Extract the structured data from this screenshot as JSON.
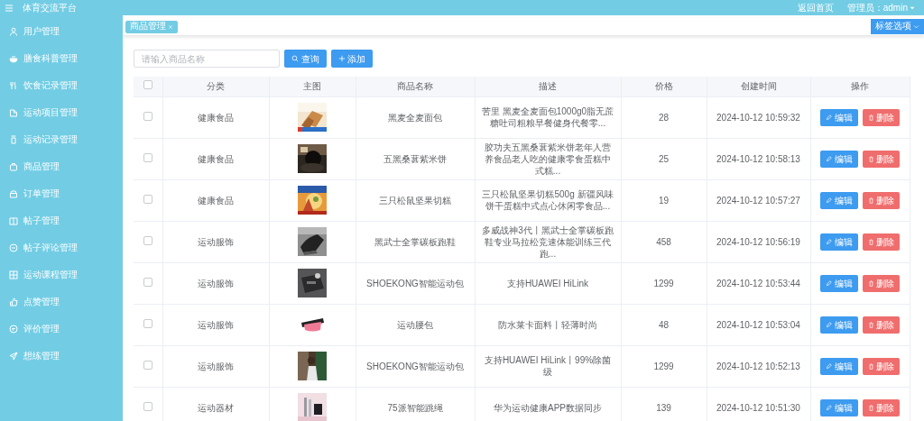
{
  "app": {
    "title": "体育交流平台"
  },
  "header": {
    "home_link": "返回首页",
    "user": "管理员：admin"
  },
  "sidebar": {
    "items": [
      {
        "label": "用户管理"
      },
      {
        "label": "膳食科普管理"
      },
      {
        "label": "饮食记录管理"
      },
      {
        "label": "运动项目管理"
      },
      {
        "label": "运动记录管理"
      },
      {
        "label": "商品管理"
      },
      {
        "label": "订单管理"
      },
      {
        "label": "帖子管理"
      },
      {
        "label": "帖子评论管理"
      },
      {
        "label": "运动课程管理"
      },
      {
        "label": "点赞管理"
      },
      {
        "label": "评价管理"
      },
      {
        "label": "想练管理"
      }
    ]
  },
  "tabs": [
    {
      "label": "商品管理",
      "selected": true
    }
  ],
  "tab_options_button": "标签选项",
  "search": {
    "placeholder": "请输入商品名称"
  },
  "buttons": [
    {
      "label": "查询",
      "kind": "search"
    },
    {
      "label": "添加",
      "kind": "add"
    }
  ],
  "table": {
    "columns": [
      "分类",
      "主图",
      "商品名称",
      "描述",
      "价格",
      "创建时间",
      "操作"
    ],
    "header_checked": false,
    "rows": [
      {
        "checked": false,
        "category": "健康食品",
        "name": "黑麦全麦面包",
        "description": "苦里 黑麦全麦面包1000g0脂无蔗糖吐司粗粮早餐健身代餐零...",
        "price": "28",
        "created": "2024-10-12 10:59:32",
        "actions": [
          {
            "label": "编辑",
            "kind": "edit"
          },
          {
            "label": "删除",
            "kind": "delete"
          }
        ]
      },
      {
        "checked": false,
        "category": "健康食品",
        "name": "五黑桑葚紫米饼",
        "description": "胶功夫五黑桑葚紫米饼老年人营养食品老人吃的健康零食蛋糕中式糕...",
        "price": "25",
        "created": "2024-10-12 10:58:13",
        "actions": [
          {
            "label": "编辑",
            "kind": "edit"
          },
          {
            "label": "删除",
            "kind": "delete"
          }
        ]
      },
      {
        "checked": false,
        "category": "健康食品",
        "name": "三只松鼠坚果切糕",
        "description": "三只松鼠坚果切糕500g 新疆风味饼干蛋糕中式点心休闲零食品...",
        "price": "19",
        "created": "2024-10-12 10:57:27",
        "actions": [
          {
            "label": "编辑",
            "kind": "edit"
          },
          {
            "label": "删除",
            "kind": "delete"
          }
        ]
      },
      {
        "checked": false,
        "category": "运动服饰",
        "name": "黑武士全掌碳板跑鞋",
        "description": "多威战神3代丨黑武士全掌碳板跑鞋专业马拉松竞速体能训练三代跑...",
        "price": "458",
        "created": "2024-10-12 10:56:19",
        "actions": [
          {
            "label": "编辑",
            "kind": "edit"
          },
          {
            "label": "删除",
            "kind": "delete"
          }
        ]
      },
      {
        "checked": false,
        "category": "运动服饰",
        "name": "SHOEKONG智能运动包",
        "description": "支持HUAWEI HiLink",
        "price": "1299",
        "created": "2024-10-12 10:53:44",
        "actions": [
          {
            "label": "编辑",
            "kind": "edit"
          },
          {
            "label": "删除",
            "kind": "delete"
          }
        ]
      },
      {
        "checked": false,
        "category": "运动服饰",
        "name": "运动腰包",
        "description": "防水莱卡面料丨轻薄时尚",
        "price": "48",
        "created": "2024-10-12 10:53:04",
        "actions": [
          {
            "label": "编辑",
            "kind": "edit"
          },
          {
            "label": "删除",
            "kind": "delete"
          }
        ]
      },
      {
        "checked": false,
        "category": "运动服饰",
        "name": "SHOEKONG智能运动包",
        "description": "支持HUAWEI HiLink丨99%除菌级",
        "price": "1299",
        "created": "2024-10-12 10:52:13",
        "actions": [
          {
            "label": "编辑",
            "kind": "edit"
          },
          {
            "label": "删除",
            "kind": "delete"
          }
        ]
      },
      {
        "checked": false,
        "category": "运动器材",
        "name": "75派智能跳绳",
        "description": "华为运动健康APP数据同步",
        "price": "139",
        "created": "2024-10-12 10:51:30",
        "actions": [
          {
            "label": "编辑",
            "kind": "edit"
          },
          {
            "label": "删除",
            "kind": "delete"
          }
        ]
      }
    ]
  }
}
